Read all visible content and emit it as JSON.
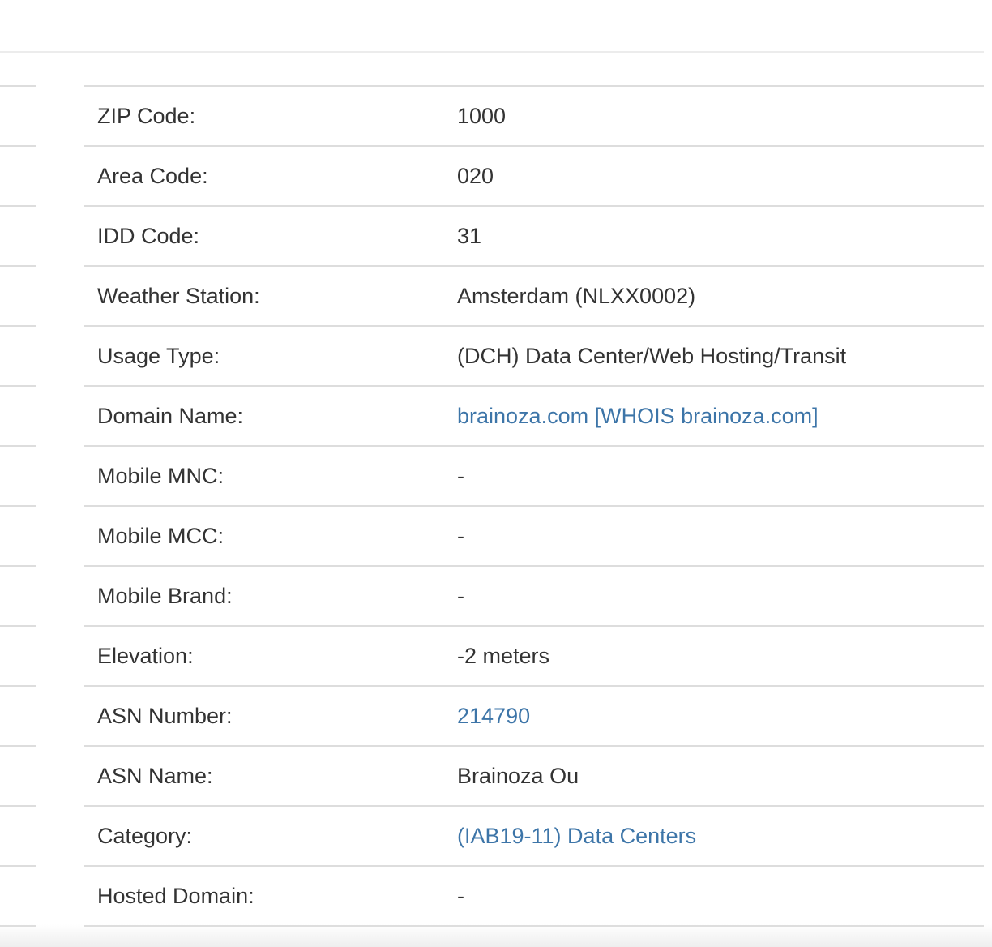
{
  "rows": [
    {
      "label": "ZIP Code:",
      "value": "1000",
      "link": false
    },
    {
      "label": "Area Code:",
      "value": "020",
      "link": false
    },
    {
      "label": "IDD Code:",
      "value": "31",
      "link": false
    },
    {
      "label": "Weather Station:",
      "value": "Amsterdam (NLXX0002)",
      "link": false
    },
    {
      "label": "Usage Type:",
      "value": "(DCH) Data Center/Web Hosting/Transit",
      "link": false
    },
    {
      "label": "Domain Name:",
      "value": "brainoza.com [WHOIS brainoza.com]",
      "link": true
    },
    {
      "label": "Mobile MNC:",
      "value": "-",
      "link": false
    },
    {
      "label": "Mobile MCC:",
      "value": "-",
      "link": false
    },
    {
      "label": "Mobile Brand:",
      "value": "-",
      "link": false
    },
    {
      "label": "Elevation:",
      "value": "-2 meters",
      "link": false
    },
    {
      "label": "ASN Number:",
      "value": "214790",
      "link": true
    },
    {
      "label": "ASN Name:",
      "value": "Brainoza Ou",
      "link": false
    },
    {
      "label": "Category:",
      "value": "(IAB19-11) Data Centers",
      "link": true
    },
    {
      "label": "Hosted Domain:",
      "value": "-",
      "link": false
    }
  ],
  "colors": {
    "link": "#3d75a8",
    "text": "#333333",
    "border": "#dddddd"
  }
}
